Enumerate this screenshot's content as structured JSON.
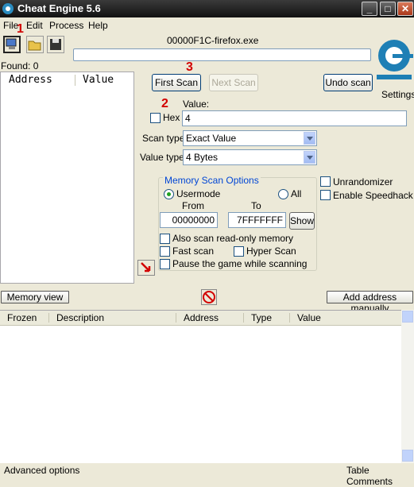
{
  "window": {
    "title": "Cheat Engine 5.6"
  },
  "menu": [
    "File",
    "Edit",
    "Process",
    "Help"
  ],
  "process_name": "00000F1C-firefox.exe",
  "found_label": "Found: 0",
  "settings_label": "Settings",
  "annotations": {
    "one": "1",
    "two": "2",
    "three": "3"
  },
  "address_list": {
    "headers": [
      "Address",
      "Value"
    ]
  },
  "scan": {
    "first_scan": "First Scan",
    "next_scan": "Next Scan",
    "undo_scan": "Undo scan",
    "value_label": "Value:",
    "value": "4",
    "hex_label": "Hex",
    "scan_type_label": "Scan type",
    "scan_type_value": "Exact Value",
    "value_type_label": "Value type",
    "value_type_value": "4 Bytes"
  },
  "memory_options": {
    "title": "Memory Scan Options",
    "usermode": "Usermode",
    "all": "All",
    "from_label": "From",
    "to_label": "To",
    "from_value": "00000000",
    "to_value": "7FFFFFFF",
    "show": "Show",
    "readonly": "Also scan read-only memory",
    "fast_scan": "Fast scan",
    "hyper_scan": "Hyper Scan",
    "pause_game": "Pause the game while scanning"
  },
  "options": {
    "unrandomizer": "Unrandomizer",
    "speedhack": "Enable Speedhack"
  },
  "buttons": {
    "memory_view": "Memory view",
    "add_address": "Add address manually"
  },
  "table": {
    "headers": [
      "Frozen",
      "Description",
      "Address",
      "Type",
      "Value"
    ]
  },
  "footer": {
    "advanced": "Advanced options",
    "comments": "Table Comments"
  },
  "colors": {
    "titlebar": "#1c1c1c",
    "annotation": "#d20000",
    "group_title": "#0046d5"
  }
}
